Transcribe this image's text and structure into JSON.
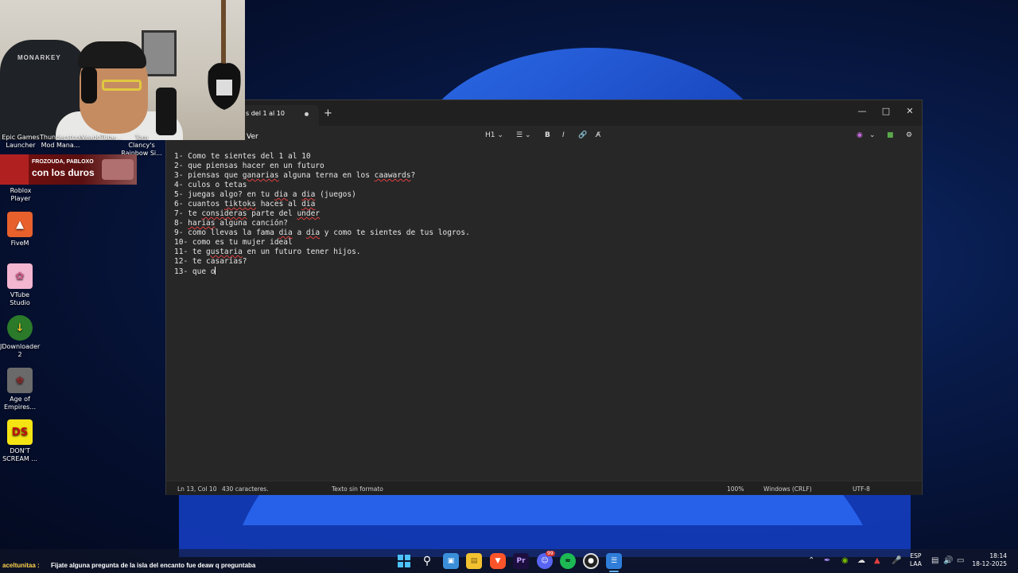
{
  "desktop": {
    "top_labels": [
      "Epic Games Launcher",
      "Thunderstore Mod Mana...",
      "VeadoTube...",
      "Tom Clancy's Rainbow Si..."
    ],
    "roblox_label": "Roblox Player",
    "icons": [
      {
        "label": "FiveM",
        "icon": "fivem-icon",
        "color": "#e8612c"
      },
      {
        "label": "VTube Studio",
        "icon": "vtube-studio-icon",
        "color": "#f3b6d0"
      },
      {
        "label": "JDownloader 2",
        "icon": "jdownloader-icon",
        "color": "#f2c230"
      },
      {
        "label": "Age of Empires...",
        "icon": "age-of-empires-icon",
        "color": "#8a2d2d"
      },
      {
        "label": "DON'T SCREAM ...",
        "icon": "dont-scream-icon",
        "color": "#f5e414"
      }
    ]
  },
  "alert": {
    "names": "FROZOUDA, PABLOXO",
    "text": "con los duros"
  },
  "notepad": {
    "tab_title": "s del 1 al 10",
    "menu_ver": "Ver",
    "toolbar": {
      "heading": "H1",
      "bold": "B",
      "italic": "I"
    },
    "lines": [
      "1- Como te sientes del 1 al 10",
      "2- que piensas hacer en un futuro",
      "3- piensas que ganarias alguna terna en los caawards?",
      "4- culos o tetas",
      "5- juegas algo? en tu dia a dia (juegos)",
      "6- cuantos tiktoks haces al dia",
      "7- te consideras parte del under",
      "8- harias alguna canción?",
      "9- como llevas la fama dia a dia y como te sientes de tus logros.",
      "10- como es tu mujer ideal",
      "11- te gustaria en un futuro tener hijos.",
      "12- te casarías?",
      "13- que o"
    ],
    "status": {
      "position": "Ln 13, Col 10",
      "chars": "430 caracteres.",
      "format": "Texto sin formato",
      "zoom": "100%",
      "line_ending": "Windows (CRLF)",
      "encoding": "UTF-8"
    }
  },
  "chat": {
    "user": "aceltunitaa :",
    "message": "Fijate alguna pregunta de la isla del encanto fue deaw q preguntaba"
  },
  "taskbar": {
    "apps": [
      "start-icon",
      "search-icon",
      "store-icon",
      "file-explorer-icon",
      "brave-icon",
      "premiere-icon",
      "discord-icon",
      "spotify-icon",
      "obs-icon",
      "notepad-icon"
    ],
    "discord_badge": "99",
    "lang_top": "ESP",
    "lang_bottom": "LAA",
    "time": "18:14",
    "date": "18-12-2025"
  },
  "colors": {
    "notepad_bg": "#272727",
    "spell_underline": "#e04040",
    "chat_user": "#ffd34a"
  }
}
